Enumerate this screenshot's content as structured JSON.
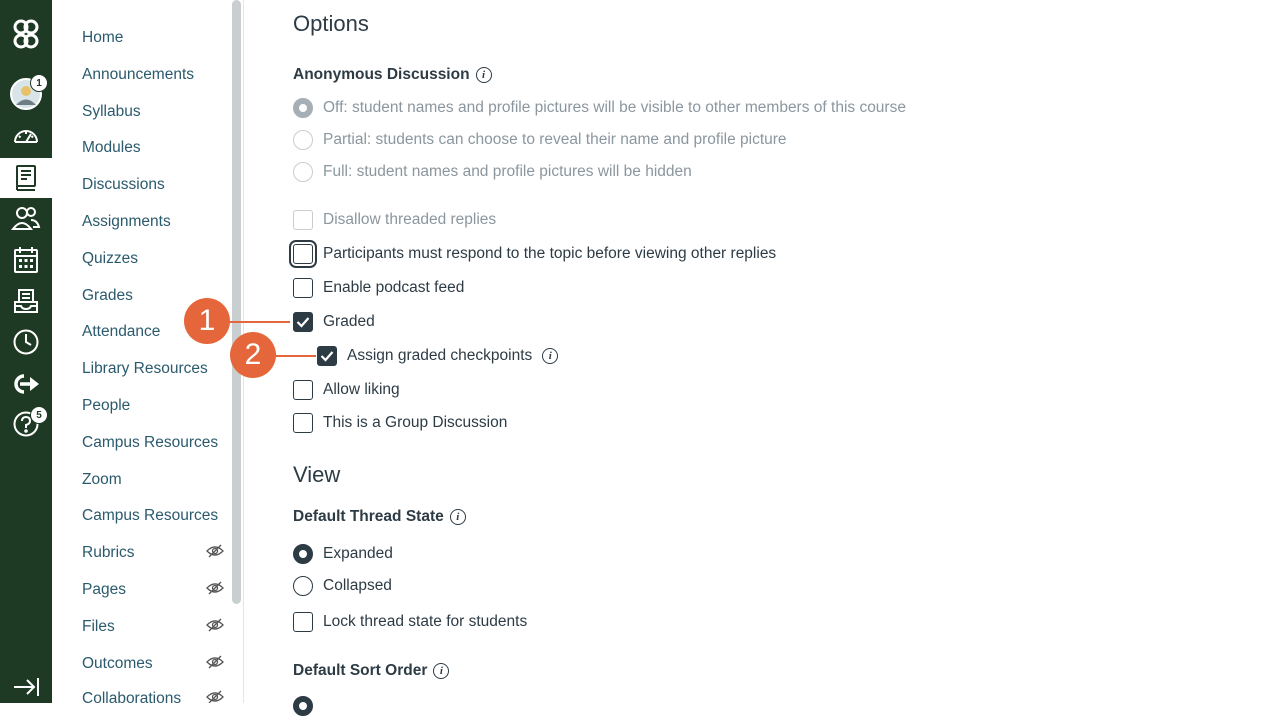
{
  "global_nav": {
    "items": [
      {
        "name": "logo",
        "icon": "portland-state-logo"
      },
      {
        "name": "account",
        "icon": "avatar",
        "badge": "1"
      },
      {
        "name": "dashboard",
        "icon": "dashboard-icon"
      },
      {
        "name": "courses",
        "icon": "courses-icon",
        "active": true
      },
      {
        "name": "groups",
        "icon": "groups-icon"
      },
      {
        "name": "calendar",
        "icon": "calendar-icon"
      },
      {
        "name": "inbox",
        "icon": "inbox-icon"
      },
      {
        "name": "history",
        "icon": "history-icon"
      },
      {
        "name": "commons",
        "icon": "commons-icon"
      },
      {
        "name": "help",
        "icon": "help-icon",
        "badge": "5"
      }
    ],
    "collapse_icon": "collapse-nav-icon"
  },
  "course_nav": {
    "items": [
      {
        "label": "Home",
        "hidden": false
      },
      {
        "label": "Announcements",
        "hidden": false
      },
      {
        "label": "Syllabus",
        "hidden": false
      },
      {
        "label": "Modules",
        "hidden": false
      },
      {
        "label": "Discussions",
        "hidden": false
      },
      {
        "label": "Assignments",
        "hidden": false
      },
      {
        "label": "Quizzes",
        "hidden": false
      },
      {
        "label": "Grades",
        "hidden": false
      },
      {
        "label": "Attendance",
        "hidden": false
      },
      {
        "label": "Library Resources",
        "hidden": false
      },
      {
        "label": "People",
        "hidden": false
      },
      {
        "label": "Campus Resources",
        "hidden": false
      },
      {
        "label": "Zoom",
        "hidden": false
      },
      {
        "label": "Campus Resources",
        "hidden": false
      },
      {
        "label": "Rubrics",
        "hidden": true
      },
      {
        "label": "Pages",
        "hidden": true
      },
      {
        "label": "Files",
        "hidden": true
      },
      {
        "label": "Outcomes",
        "hidden": true
      },
      {
        "label": "Collaborations",
        "hidden": true
      }
    ]
  },
  "options": {
    "heading": "Options",
    "anonymous_label": "Anonymous Discussion",
    "anonymous_options": [
      "Off: student names and profile pictures will be visible to other members of this course",
      "Partial: students can choose to reveal their name and profile picture",
      "Full: student names and profile pictures will be hidden"
    ],
    "checkboxes": {
      "disallow_threaded": "Disallow threaded replies",
      "must_respond": "Participants must respond to the topic before viewing other replies",
      "podcast": "Enable podcast feed",
      "graded": "Graded",
      "checkpoints": "Assign graded checkpoints",
      "liking": "Allow liking",
      "group": "This is a Group Discussion"
    }
  },
  "view": {
    "heading": "View",
    "thread_state_label": "Default Thread State",
    "expanded": "Expanded",
    "collapsed": "Collapsed",
    "lock_thread": "Lock thread state for students",
    "sort_order_label": "Default Sort Order"
  },
  "callouts": {
    "first": "1",
    "second": "2"
  },
  "colors": {
    "nav_bg": "#1f3a24",
    "link": "#2b5a6d",
    "text": "#2d3b45",
    "callout": "#e5663a"
  }
}
